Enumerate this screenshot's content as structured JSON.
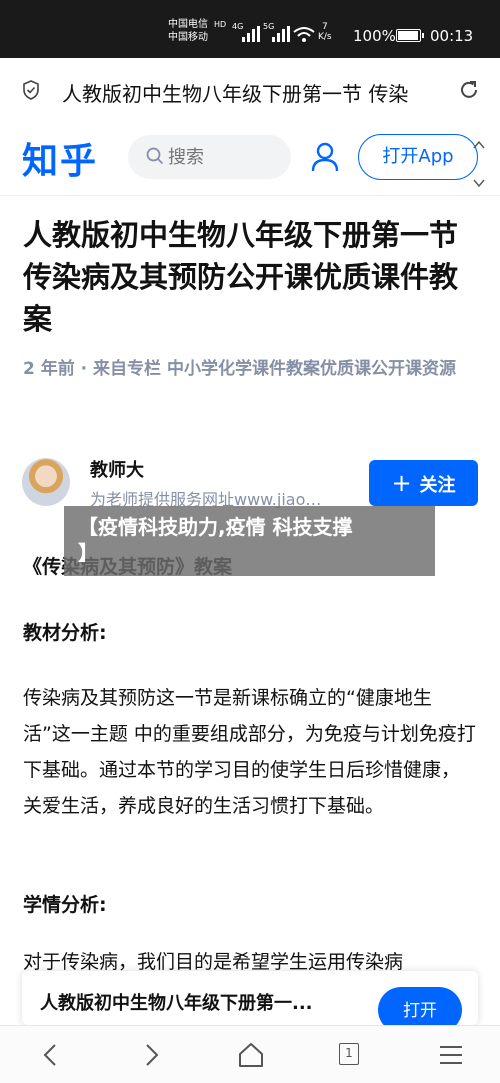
{
  "status_bar": {
    "carrier1": "中国电信",
    "carrier2": "中国移动",
    "hd": "HD",
    "net1": "4G",
    "net2": "5G",
    "speed_value": "7",
    "speed_unit": "K/s",
    "battery": "100%",
    "battery_level": 1.0,
    "time": "00:13"
  },
  "browser": {
    "page_title": "人教版初中生物八年级下册第一节 传染"
  },
  "header": {
    "logo": "知乎",
    "search_placeholder": "搜索",
    "open_app": "打开App"
  },
  "article": {
    "title": "人教版初中生物八年级下册第一节 传染病及其预防公开课优质课件教案",
    "meta": "2 年前 · 来自专栏 中小学化学课件教案优质课公开课资源",
    "author_name": "教师大",
    "author_desc": "为老师提供服务网址www.jiao…",
    "follow_label": "关注",
    "overlay_line1": "【疫情科技助力,疫情 科技支撑",
    "overlay_line2": "】",
    "body_line1": "《传染病及其预防》教案",
    "section1": "教材分析:",
    "para1": "传染病及其预防这一节是新课标确立的“健康地生活”这一主题 中的重要组成部分，为免疫与计划免疫打下基础。通过本节的学习目的使学生日后珍惜健康，关爱生活，养成良好的生活习惯打下基础。",
    "section2": "学情分析:",
    "para2_partial": "对于传染病，我们目的是希望学生运用传染病"
  },
  "app_banner": {
    "title": "人教版初中生物八年级下册第一...",
    "open": "打开"
  },
  "bottom_nav": {
    "tab_count": "1"
  },
  "colors": {
    "brand": "#0066ff",
    "meta_gray": "#8590a6",
    "status_bar_bg": "#1a1a1a"
  }
}
